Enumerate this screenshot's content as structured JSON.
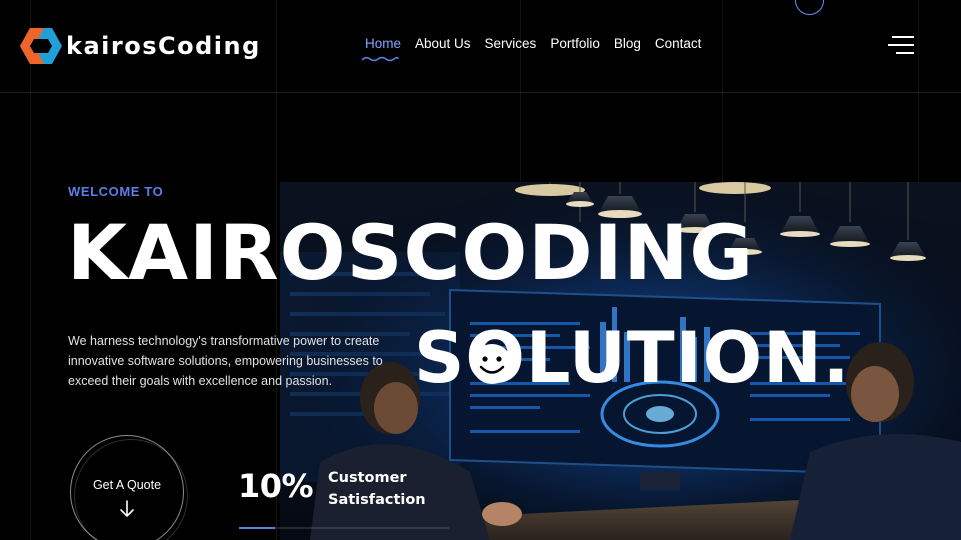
{
  "brand": {
    "name": "kairosCoding",
    "logo_colors": [
      "#f0642a",
      "#1fa0d8"
    ]
  },
  "nav": {
    "items": [
      {
        "label": "Home",
        "active": true
      },
      {
        "label": "About Us",
        "active": false
      },
      {
        "label": "Services",
        "active": false
      },
      {
        "label": "Portfolio",
        "active": false
      },
      {
        "label": "Blog",
        "active": false
      },
      {
        "label": "Contact",
        "active": false
      }
    ],
    "menu_icon": "hamburger-menu-icon"
  },
  "hero": {
    "eyebrow": "WELCOME TO",
    "title": "KAIROSCODING",
    "subtitle": "SOLUTION.",
    "description": "We harness technology's transformative power to create innovative software solutions, empowering businesses to exceed their goals with excellence and passion.",
    "cta": {
      "label": "Get A Quote",
      "icon": "arrow-down-icon"
    },
    "stat": {
      "value": "10%",
      "label": "Customer Satisfaction",
      "progress": 0.17
    }
  },
  "colors": {
    "accent": "#5b7ee8",
    "nav_active": "#7ea6ff",
    "background": "#000000"
  }
}
